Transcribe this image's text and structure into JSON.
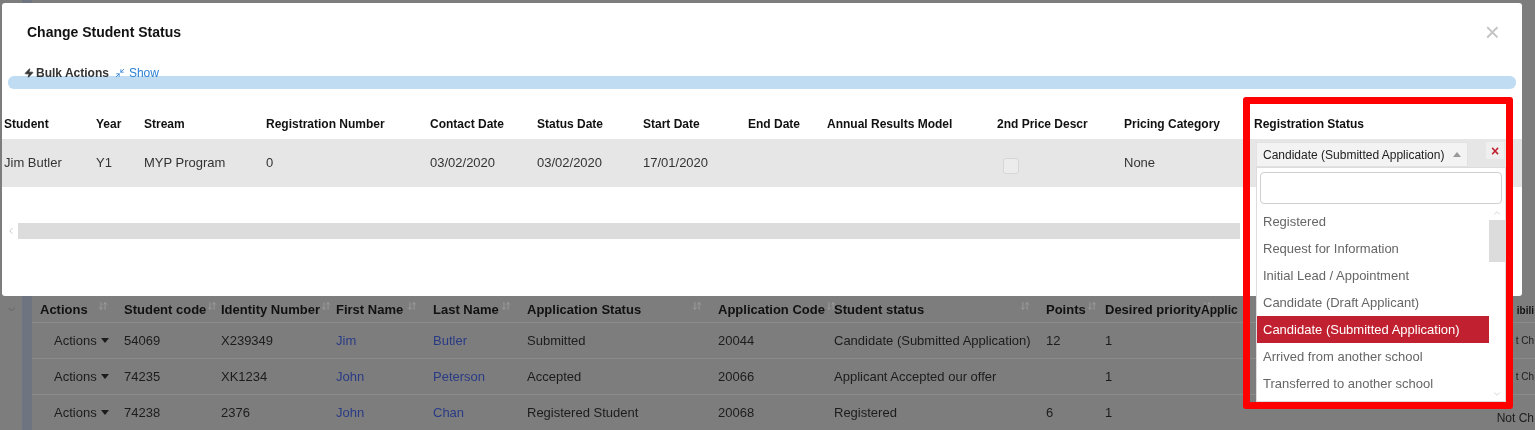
{
  "background_table": {
    "columns": [
      {
        "label": "Actions",
        "sortable": true
      },
      {
        "label": "Student code",
        "sortable": true
      },
      {
        "label": "Identity Number",
        "sortable": true
      },
      {
        "label": "First Name",
        "sortable": true
      },
      {
        "label": "Last Name",
        "sortable": true
      },
      {
        "label": "Application Status",
        "sortable": true
      },
      {
        "label": "Application Code",
        "sortable": true
      },
      {
        "label": "Student status",
        "sortable": true
      },
      {
        "label": "Points",
        "sortable": true
      },
      {
        "label": "Desired priority",
        "sortable": true
      },
      {
        "label": "Applic",
        "sortable": false
      },
      {
        "label": "ibili",
        "sortable": false
      }
    ],
    "rows": [
      {
        "cells": [
          {
            "kind": "menu",
            "text": "Actions"
          },
          {
            "kind": "text",
            "text": "54069"
          },
          {
            "kind": "text",
            "text": "X239349"
          },
          {
            "kind": "link",
            "text": "Jim"
          },
          {
            "kind": "link",
            "text": "Butler"
          },
          {
            "kind": "text",
            "text": "Submitted"
          },
          {
            "kind": "text",
            "text": "20044"
          },
          {
            "kind": "text",
            "text": "Candidate (Submitted Application)"
          },
          {
            "kind": "text",
            "text": "12"
          },
          {
            "kind": "text",
            "text": "1"
          },
          {
            "kind": "empty"
          },
          {
            "kind": "text",
            "text": "t Ch"
          }
        ]
      },
      {
        "cells": [
          {
            "kind": "menu",
            "text": "Actions"
          },
          {
            "kind": "text",
            "text": "74235"
          },
          {
            "kind": "text",
            "text": "XK1234"
          },
          {
            "kind": "link",
            "text": "John"
          },
          {
            "kind": "link",
            "text": "Peterson"
          },
          {
            "kind": "text",
            "text": "Accepted"
          },
          {
            "kind": "text",
            "text": "20066"
          },
          {
            "kind": "text",
            "text": "Applicant Accepted our offer"
          },
          {
            "kind": "empty"
          },
          {
            "kind": "text",
            "text": "1"
          },
          {
            "kind": "empty"
          },
          {
            "kind": "text",
            "text": "t Ch"
          }
        ]
      },
      {
        "cells": [
          {
            "kind": "menu",
            "text": "Actions"
          },
          {
            "kind": "text",
            "text": "74238"
          },
          {
            "kind": "text",
            "text": "2376"
          },
          {
            "kind": "link",
            "text": "John"
          },
          {
            "kind": "link",
            "text": "Chan"
          },
          {
            "kind": "text",
            "text": "Registered Student"
          },
          {
            "kind": "text",
            "text": "20068"
          },
          {
            "kind": "text",
            "text": "Registered"
          },
          {
            "kind": "text",
            "text": "6"
          },
          {
            "kind": "text",
            "text": "1"
          },
          {
            "kind": "empty"
          },
          {
            "kind": "text",
            "text": "Not Ch"
          }
        ]
      }
    ]
  },
  "modal": {
    "title": "Change Student Status",
    "close": "×",
    "bulk_actions": {
      "label": "Bulk Actions",
      "show_link": "Show"
    },
    "columns": [
      "Student",
      "Year",
      "Stream",
      "Registration Number",
      "Contact Date",
      "Status Date",
      "Start Date",
      "End Date",
      "Annual Results Model",
      "2nd Price Descr",
      "Pricing Category",
      "Registration Status"
    ],
    "rows": [
      {
        "cells": [
          {
            "kind": "text",
            "text": "Jim Butler"
          },
          {
            "kind": "text",
            "text": "Y1"
          },
          {
            "kind": "text",
            "text": "MYP Program"
          },
          {
            "kind": "text",
            "text": "0"
          },
          {
            "kind": "text",
            "text": "03/02/2020"
          },
          {
            "kind": "text",
            "text": "03/02/2020"
          },
          {
            "kind": "text",
            "text": "17/01/2020"
          },
          {
            "kind": "empty"
          },
          {
            "kind": "empty"
          },
          {
            "kind": "checkbox",
            "checked": false
          },
          {
            "kind": "text",
            "text": "None"
          },
          {
            "kind": "empty"
          }
        ]
      }
    ],
    "registration_status": {
      "value": "Candidate (Submitted Application)",
      "expanded": true,
      "remove": "×",
      "options": [
        {
          "label": "Registered",
          "selected": false
        },
        {
          "label": "Request for Information",
          "selected": false
        },
        {
          "label": "Initial Lead / Appointment",
          "selected": false
        },
        {
          "label": "Candidate (Draft Applicant)",
          "selected": false
        },
        {
          "label": "Candidate (Submitted Application)",
          "selected": true
        },
        {
          "label": "Arrived from another school",
          "selected": false
        },
        {
          "label": "Transferred to another school",
          "selected": false
        }
      ]
    }
  }
}
